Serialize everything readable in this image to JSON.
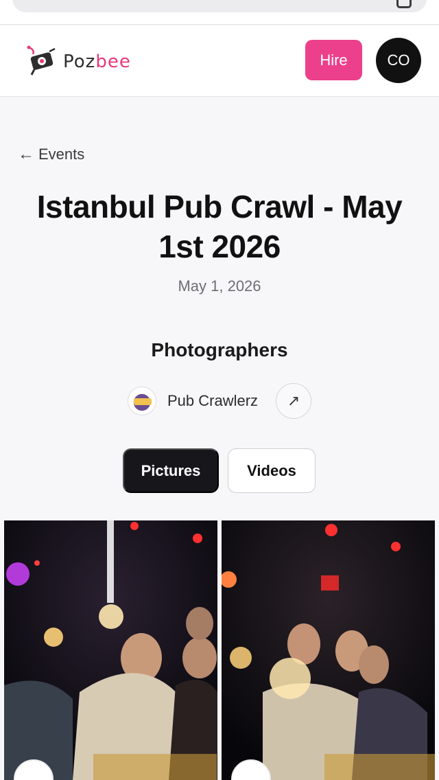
{
  "browser": {
    "tabs_icon": "tabs-icon"
  },
  "header": {
    "logo_prefix": "Poz",
    "logo_suffix": "bee",
    "logo_icon": "camera-bee-logo",
    "hire_label": "Hire",
    "avatar_initials": "CO",
    "colors": {
      "brand_pink": "#ec3f8c",
      "avatar_bg": "#111111"
    }
  },
  "page": {
    "back_arrow": "←",
    "back_label": "Events",
    "title": "Istanbul Pub Crawl - May 1st 2026",
    "date": "May 1, 2026",
    "photographers_heading": "Photographers"
  },
  "photographers": [
    {
      "name": "Pub Crawlerz",
      "avatar_icon": "pub-crawlerz-logo",
      "link_icon": "arrow-up-right-icon",
      "link_glyph": "↗"
    }
  ],
  "tabs": [
    {
      "label": "Pictures",
      "active": true
    },
    {
      "label": "Videos",
      "active": false
    }
  ],
  "gallery": {
    "items": [
      {
        "type": "photo",
        "subject": "party-photo-sparklers"
      },
      {
        "type": "photo",
        "subject": "party-photo-group"
      }
    ]
  }
}
